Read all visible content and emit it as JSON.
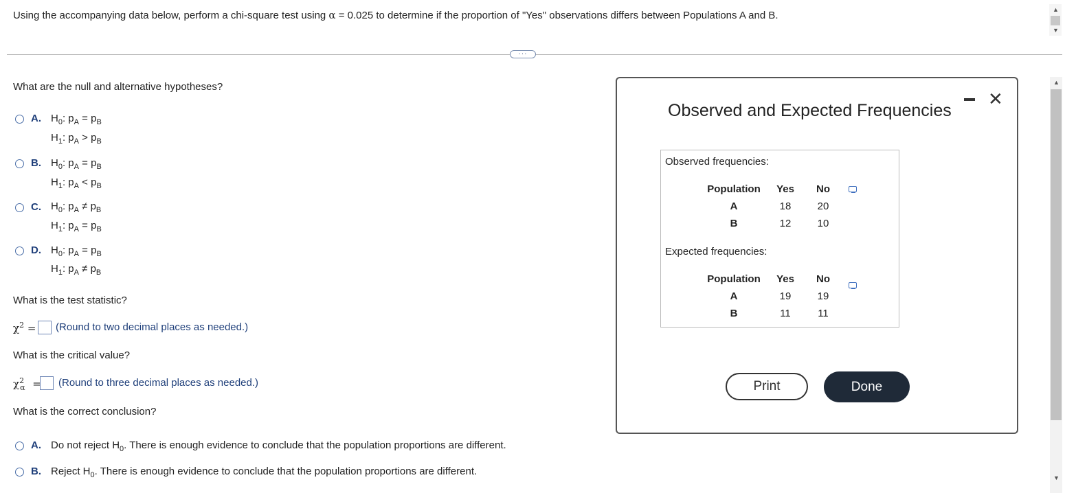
{
  "question": {
    "prefix": "Using the accompanying data below, perform a chi-square test using ",
    "alpha_symbol": "α",
    "alpha_eq": " = 0.025 to determine if the proportion of \"Yes\" observations differs between Populations A and B."
  },
  "more_label": "···",
  "hypotheses": {
    "prompt": "What are the null and alternative hypotheses?",
    "options": [
      {
        "letter": "A.",
        "h0": "p",
        "h1_rel": ">"
      },
      {
        "letter": "B.",
        "h1_rel": "<"
      },
      {
        "letter": "C.",
        "h0_rel": "≠",
        "h1_rel": "="
      },
      {
        "letter": "D.",
        "h0_rel": "=",
        "h1_rel": "≠"
      }
    ]
  },
  "test_statistic": {
    "prompt": "What is the test statistic?",
    "hint": "(Round to two decimal places as needed.)"
  },
  "critical_value": {
    "prompt": "What is the critical value?",
    "hint": "(Round to three decimal places as needed.)"
  },
  "conclusion": {
    "prompt": "What is the correct conclusion?",
    "options": [
      {
        "letter": "A.",
        "pre": "Do not reject H",
        "post": ". There is enough evidence to conclude that the population proportions are different."
      },
      {
        "letter": "B.",
        "pre": "Reject H",
        "post": ". There is enough evidence to conclude that the population proportions are different."
      }
    ]
  },
  "dialog": {
    "title": "Observed and Expected Frequencies",
    "observed_label": "Observed frequencies:",
    "expected_label": "Expected frequencies:",
    "headers": [
      "Population",
      "Yes",
      "No"
    ],
    "observed": [
      [
        "A",
        "18",
        "20"
      ],
      [
        "B",
        "12",
        "10"
      ]
    ],
    "expected": [
      [
        "A",
        "19",
        "19"
      ],
      [
        "B",
        "11",
        "11"
      ]
    ],
    "print_label": "Print",
    "done_label": "Done"
  }
}
